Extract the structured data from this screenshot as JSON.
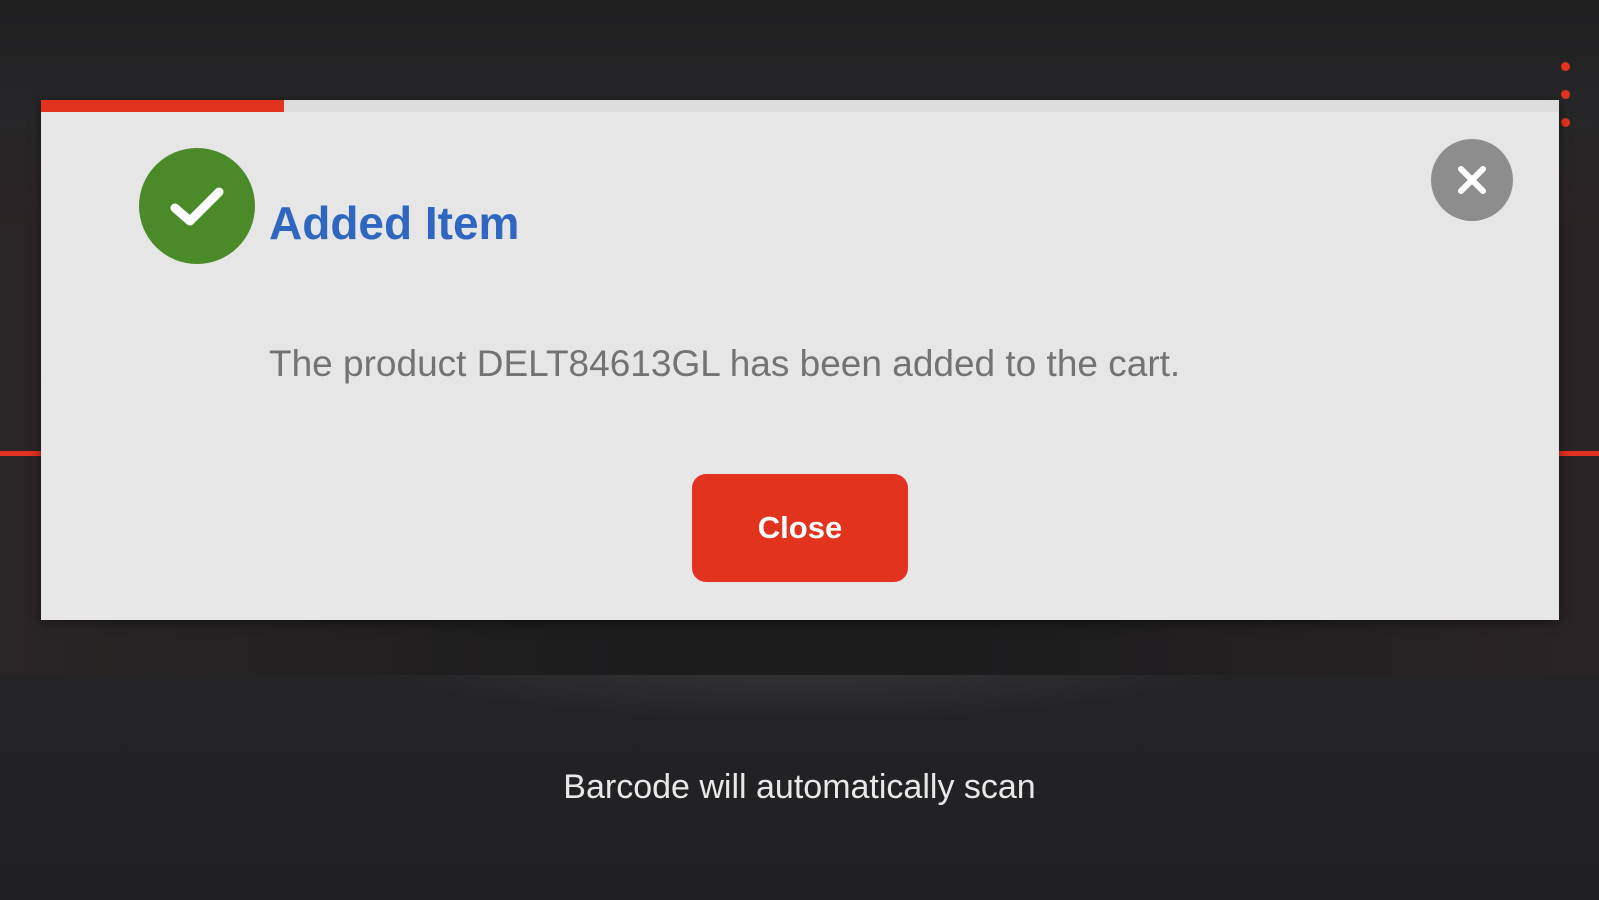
{
  "dialog": {
    "title": "Added Item",
    "message": "The product DELT84613GL has been added to the cart.",
    "close_button_label": "Close",
    "auto_dismiss_progress": 0.16,
    "success_icon": "check-circle-icon",
    "dismiss_icon": "close-icon"
  },
  "scanner": {
    "hint": "Barcode will automatically scan",
    "menu_icon": "more-vertical-icon"
  },
  "colors": {
    "accent": "#e2331f",
    "success": "#4a8a28",
    "title": "#2f67c0",
    "dialog_background": "#e6e6e6"
  }
}
